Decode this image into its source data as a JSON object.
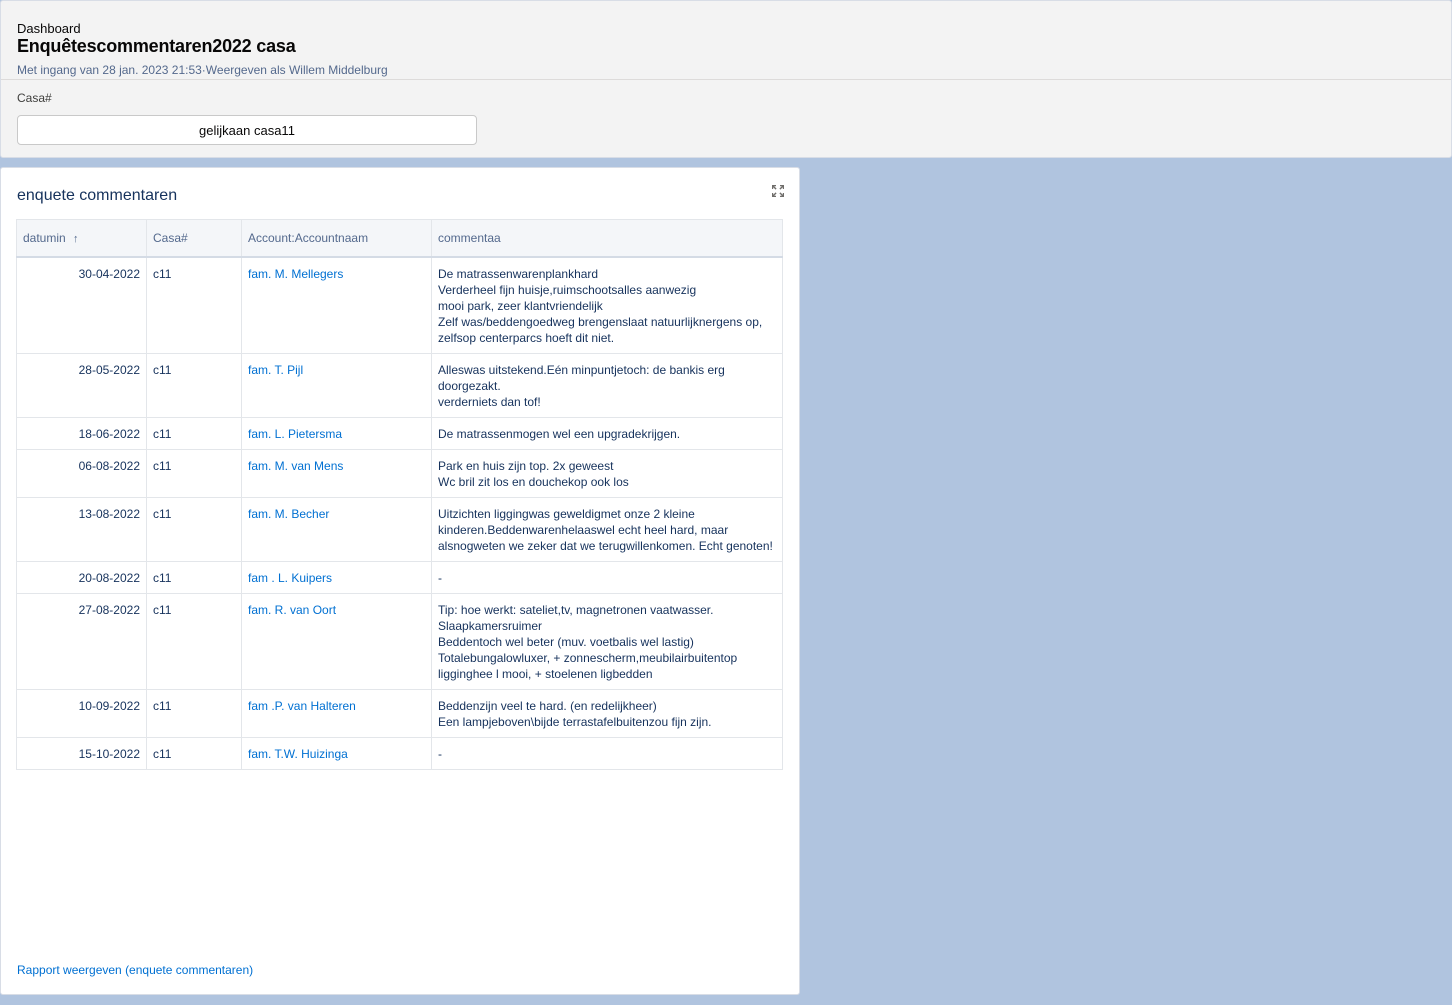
{
  "header": {
    "eyebrow": "Dashboard",
    "title": "Enquêtescommentaren2022 casa",
    "meta": "Met ingang van 28 jan. 2023 21:53·Weergeven als Willem Middelburg",
    "filter_label": "Casa#",
    "filter_value": "gelijkaan casa11"
  },
  "card": {
    "title": "enquete commentaren",
    "expand_icon": "expand-icon",
    "report_link": "Rapport weergeven (enquete commentaren)"
  },
  "table": {
    "columns": [
      "datumin",
      "Casa#",
      "Account:Accountnaam",
      "commentaa"
    ],
    "sort_icon": "↑",
    "rows": [
      {
        "date": "30-04-2022",
        "casa": "c11",
        "account": "fam. M. Mellegers",
        "comment": "De matrassenwarenplankhard\nVerderheel fijn huisje,ruimschootsalles aanwezig\nmooi park, zeer klantvriendelijk\nZelf was/beddengoedweg brengenslaat natuurlijknergens op, zelfsop centerparcs hoeft dit niet."
      },
      {
        "date": "28-05-2022",
        "casa": "c11",
        "account": "fam. T. Pijl",
        "comment": "Alleswas uitstekend.Eén minpuntjetoch: de bankis erg doorgezakt.\nverderniets dan tof!"
      },
      {
        "date": "18-06-2022",
        "casa": "c11",
        "account": "fam. L. Pietersma",
        "comment": "De matrassenmogen wel een upgradekrijgen."
      },
      {
        "date": "06-08-2022",
        "casa": "c11",
        "account": "fam. M. van Mens",
        "comment": "Park en huis zijn top. 2x geweest\nWc bril zit los en douchekop ook los"
      },
      {
        "date": "13-08-2022",
        "casa": "c11",
        "account": "fam. M. Becher",
        "comment": "Uitzichten liggingwas geweldigmet onze 2 kleine kinderen.Beddenwarenhelaaswel echt heel hard, maar alsnogweten we zeker dat we terugwillenkomen. Echt genoten!"
      },
      {
        "date": "20-08-2022",
        "casa": "c11",
        "account": "fam . L. Kuipers",
        "comment": "-"
      },
      {
        "date": "27-08-2022",
        "casa": "c11",
        "account": "fam. R. van Oort",
        "comment": "Tip: hoe werkt: sateliet,tv, magnetronen vaatwasser.\nSlaapkamersruimer\nBeddentoch wel beter (muv. voetbalis wel lastig)\nTotalebungalowluxer, + zonnescherm,meubilairbuitentop ligginghee l mooi, + stoelenen ligbedden"
      },
      {
        "date": "10-09-2022",
        "casa": "c11",
        "account": "fam .P. van Halteren",
        "comment": "Beddenzijn veel te hard. (en redelijkheer)\nEen lampjeboven\\bijde terrastafelbuitenzou fijn zijn."
      },
      {
        "date": "15-10-2022",
        "casa": "c11",
        "account": "fam. T.W. Huizinga",
        "comment": "-"
      }
    ]
  }
}
